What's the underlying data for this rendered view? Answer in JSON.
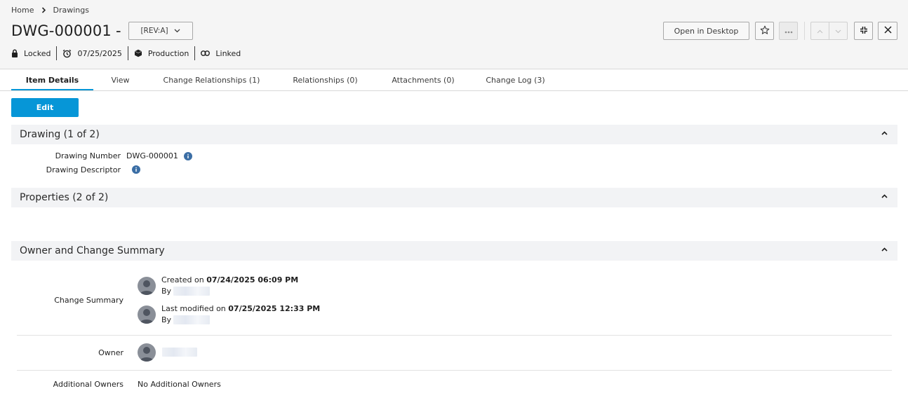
{
  "breadcrumb": {
    "home": "Home",
    "current": "Drawings"
  },
  "item": {
    "title": "DWG-000001",
    "dash": "-",
    "revision": "[REV:A]",
    "status": {
      "lock": "Locked",
      "date": "07/25/2025",
      "lifecycle": "Production",
      "link": "Linked"
    }
  },
  "toolbar": {
    "open_desktop": "Open in Desktop"
  },
  "tabs": [
    {
      "label": "Item Details",
      "active": true
    },
    {
      "label": "View"
    },
    {
      "label": "Change Relationships (1)"
    },
    {
      "label": "Relationships (0)"
    },
    {
      "label": "Attachments (0)"
    },
    {
      "label": "Change Log (3)"
    }
  ],
  "edit_label": "Edit",
  "sections": {
    "drawing": {
      "title": "Drawing (1 of 2)",
      "fields": [
        {
          "label": "Drawing Number",
          "value": "DWG-000001"
        },
        {
          "label": "Drawing Descriptor",
          "value": ""
        }
      ]
    },
    "properties": {
      "title": "Properties (2 of 2)"
    },
    "owner": {
      "title": "Owner and Change Summary",
      "change_summary_label": "Change Summary",
      "created_prefix": "Created on ",
      "created_date": "07/24/2025 06:09 PM",
      "created_by": "By",
      "modified_prefix": "Last modified on ",
      "modified_date": "07/25/2025 12:33 PM",
      "modified_by": "By",
      "owner_label": "Owner",
      "additional_owners_label": "Additional Owners",
      "additional_owners_value": "No Additional Owners"
    }
  },
  "colors": {
    "accent": "#0696d7",
    "section_bg": "#f2f3f5",
    "header_bg": "#f5f5f5",
    "info_icon": "#3b6ea5"
  }
}
